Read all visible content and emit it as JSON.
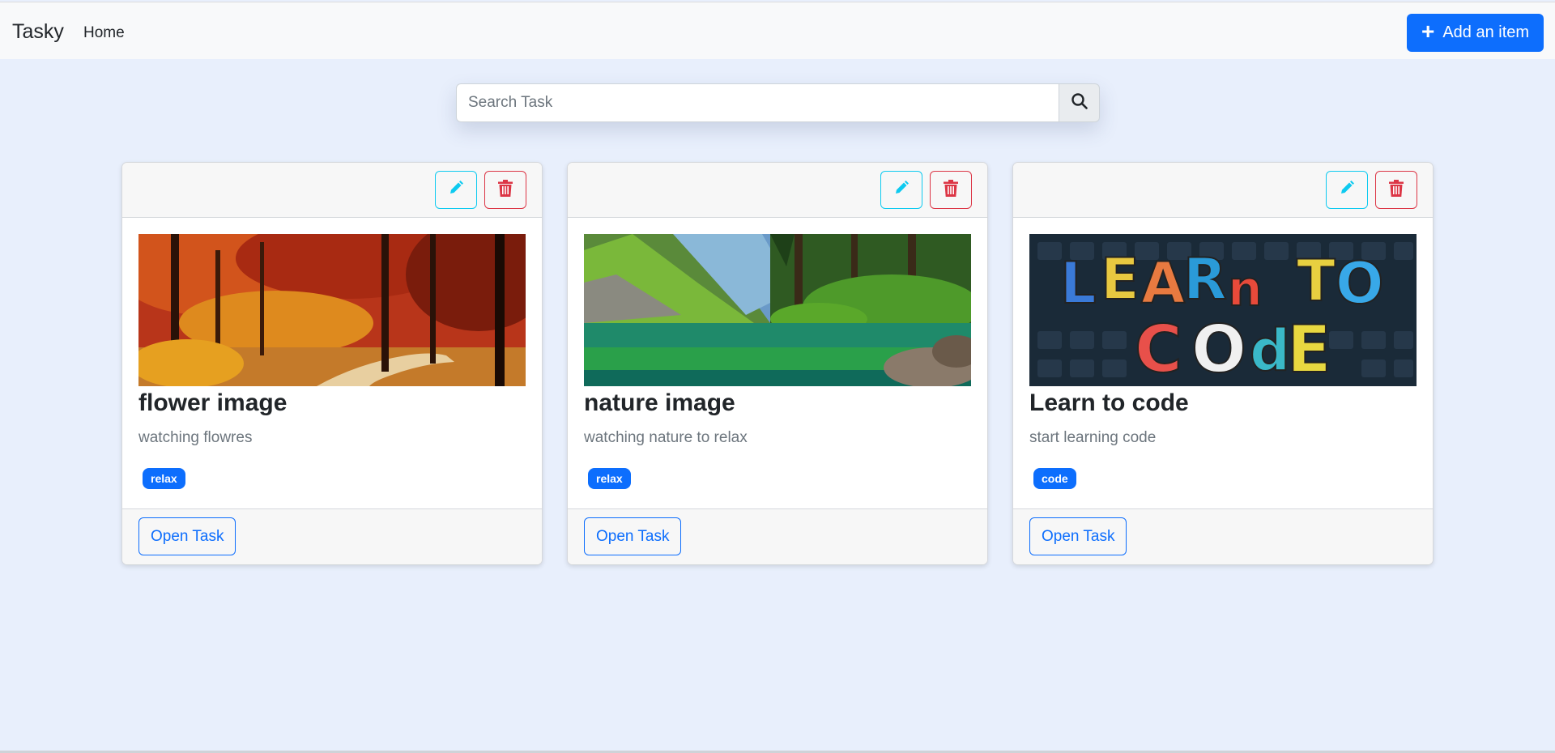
{
  "navbar": {
    "brand": "Tasky",
    "home_label": "Home",
    "add_button_label": "Add an item"
  },
  "search": {
    "placeholder": "Search Task",
    "value": ""
  },
  "colors": {
    "primary": "#0d6efd",
    "info": "#0dcaf0",
    "danger": "#dc3545",
    "page_bg": "#e8effc"
  },
  "cards": [
    {
      "image": "autumn-forest-image",
      "title": "flower image",
      "text": "watching flowres",
      "badge": "relax",
      "open_label": "Open Task"
    },
    {
      "image": "mountain-lake-image",
      "title": "nature image",
      "text": "watching nature to relax",
      "badge": "relax",
      "open_label": "Open Task"
    },
    {
      "image": "learn-to-code-image",
      "title": "Learn to code",
      "text": "start learning code",
      "badge": "code",
      "open_label": "Open Task",
      "image_text": "LEARn TO COdE"
    }
  ]
}
